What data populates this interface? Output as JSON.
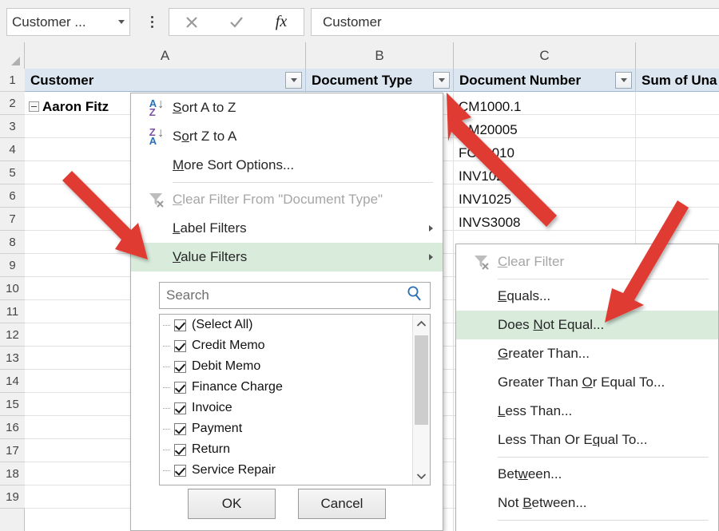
{
  "app": {
    "name_box_value": "Customer ...",
    "formula_value": "Customer",
    "icons": {
      "cancel": "✕",
      "confirm": "✓",
      "fx": "fx",
      "kebab": "more-options"
    }
  },
  "grid": {
    "column_headers": [
      "A",
      "B",
      "C"
    ],
    "row_numbers": [
      "1",
      "2",
      "3",
      "4",
      "5",
      "6",
      "7",
      "8",
      "9",
      "10",
      "11",
      "12",
      "13",
      "14",
      "15",
      "16",
      "17",
      "18",
      "19"
    ],
    "pivot_headers": [
      {
        "label": "Customer",
        "has_filter": true
      },
      {
        "label": "Document Type",
        "has_filter": true
      },
      {
        "label": "Document Number",
        "has_filter": true
      },
      {
        "label": "Sum of Una",
        "has_filter": false
      }
    ],
    "cell_a2": "Aaron Fitz",
    "column_c_values": [
      "CM1000.1",
      "DM20005",
      "FC20010",
      "INV1024",
      "INV1025",
      "INVS3008"
    ]
  },
  "filter_menu": {
    "items": [
      {
        "label": "Sort A to Z",
        "mnemonic": "S",
        "icon": "sort-az-icon",
        "state": "normal",
        "submenu": false
      },
      {
        "label": "Sort Z to A",
        "mnemonic": "o",
        "icon": "sort-za-icon",
        "state": "normal",
        "submenu": false
      },
      {
        "label": "More Sort Options...",
        "mnemonic": "M",
        "icon": "none",
        "state": "normal",
        "submenu": false
      },
      {
        "label": "Clear Filter From \"Document Type\"",
        "mnemonic": "C",
        "icon": "clear-filter-icon",
        "state": "disabled",
        "submenu": false
      },
      {
        "label": "Label Filters",
        "mnemonic": "L",
        "icon": "none",
        "state": "normal",
        "submenu": true
      },
      {
        "label": "Value Filters",
        "mnemonic": "V",
        "icon": "none",
        "state": "highlighted",
        "submenu": true
      }
    ],
    "search_placeholder": "Search",
    "search_icon": "search-icon",
    "checkbox_items": [
      {
        "label": "(Select All)",
        "checked": true
      },
      {
        "label": "Credit Memo",
        "checked": true
      },
      {
        "label": "Debit Memo",
        "checked": true
      },
      {
        "label": "Finance Charge",
        "checked": true
      },
      {
        "label": "Invoice",
        "checked": true
      },
      {
        "label": "Payment",
        "checked": true
      },
      {
        "label": "Return",
        "checked": true
      },
      {
        "label": "Service Repair",
        "checked": true
      }
    ],
    "ok_label": "OK",
    "cancel_label": "Cancel"
  },
  "value_filters_submenu": {
    "items": [
      {
        "label": "Clear Filter",
        "mnemonic": "C",
        "icon": "clear-filter-icon",
        "state": "disabled"
      },
      {
        "label": "Equals...",
        "mnemonic": "E",
        "icon": "none",
        "state": "normal"
      },
      {
        "label": "Does Not Equal...",
        "mnemonic": "N",
        "icon": "none",
        "state": "highlighted"
      },
      {
        "label": "Greater Than...",
        "mnemonic": "G",
        "icon": "none",
        "state": "normal"
      },
      {
        "label": "Greater Than Or Equal To...",
        "mnemonic": "O",
        "icon": "none",
        "state": "normal"
      },
      {
        "label": "Less Than...",
        "mnemonic": "L",
        "icon": "none",
        "state": "normal"
      },
      {
        "label": "Less Than Or Equal To...",
        "mnemonic": "q",
        "icon": "none",
        "state": "normal"
      },
      {
        "label": "Between...",
        "mnemonic": "w",
        "icon": "none",
        "state": "normal"
      },
      {
        "label": "Not Between...",
        "mnemonic": "B",
        "icon": "none",
        "state": "normal"
      }
    ]
  },
  "annotations": {
    "arrow_color": "#e03a30",
    "arrows": [
      {
        "name": "arrow-to-document-type-filter-button",
        "points_to": "Document Type filter dropdown"
      },
      {
        "name": "arrow-to-value-filters",
        "points_to": "Value Filters menu item"
      },
      {
        "name": "arrow-to-does-not-equal",
        "points_to": "Does Not Equal... submenu item"
      }
    ]
  },
  "colors": {
    "highlight_green": "#d9ecdc",
    "header_blue": "#dce6f1",
    "accent_red": "#e03a30"
  }
}
